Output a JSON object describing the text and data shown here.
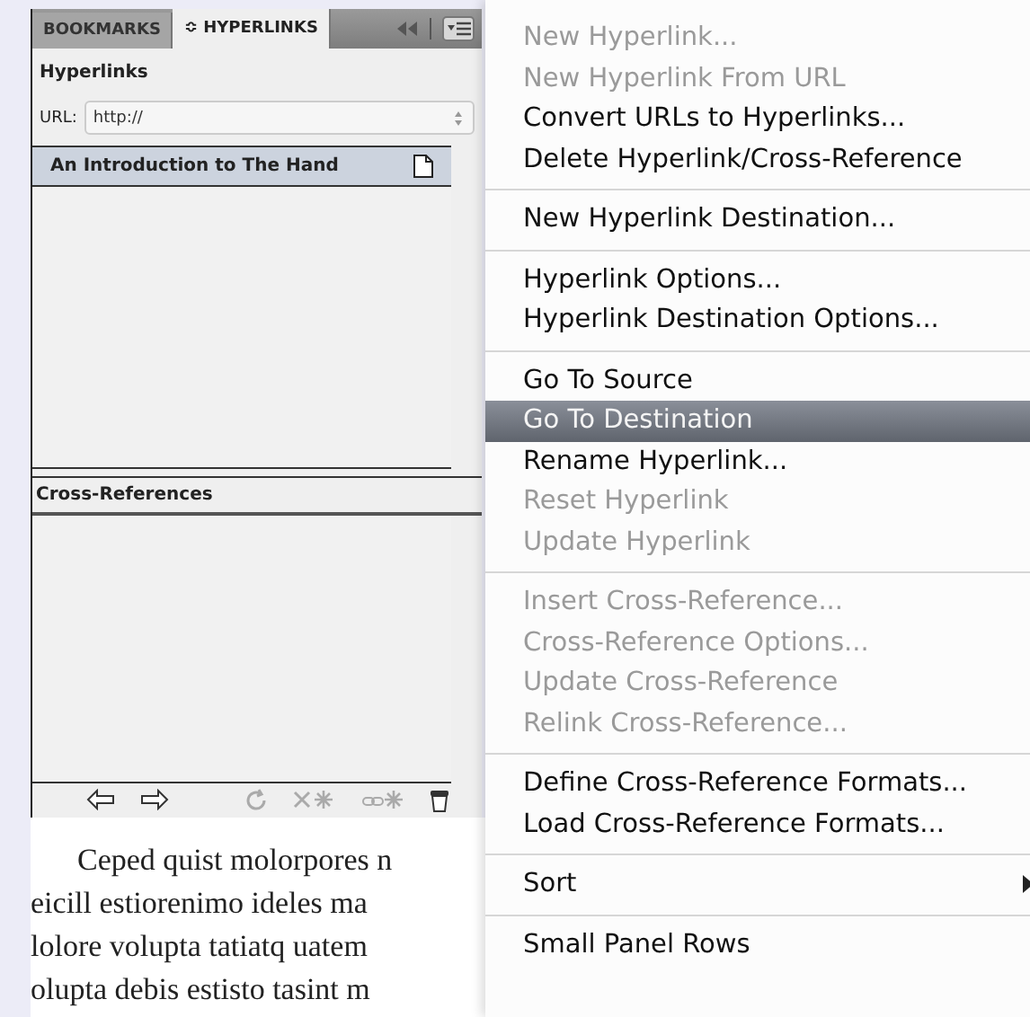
{
  "panel": {
    "tabs": [
      {
        "label": "BOOKMARKS",
        "selected": false
      },
      {
        "label": "≎ HYPERLINKS",
        "selected": true
      }
    ],
    "section_title": "Hyperlinks",
    "url_label": "URL:",
    "url_value": "http://",
    "hyperlinks": [
      {
        "name": "An Introduction to The Hand",
        "selected": true
      }
    ],
    "cross_references_title": "Cross-References"
  },
  "document": {
    "lines": [
      "Ceped quist molorpores n",
      "eicill estiorenimo ideles ma",
      "lolore volupta tatiatq uatem",
      "olupta debis estisto tasint m"
    ]
  },
  "menu": {
    "groups": [
      [
        {
          "label": "New Hyperlink...",
          "disabled": true,
          "selected": false,
          "submenu": false
        },
        {
          "label": "New Hyperlink From URL",
          "disabled": true,
          "selected": false,
          "submenu": false
        },
        {
          "label": "Convert URLs to Hyperlinks...",
          "disabled": false,
          "selected": false,
          "submenu": false
        },
        {
          "label": "Delete Hyperlink/Cross-Reference",
          "disabled": false,
          "selected": false,
          "submenu": false
        }
      ],
      [
        {
          "label": "New Hyperlink Destination...",
          "disabled": false,
          "selected": false,
          "submenu": false
        }
      ],
      [
        {
          "label": "Hyperlink Options...",
          "disabled": false,
          "selected": false,
          "submenu": false
        },
        {
          "label": "Hyperlink Destination Options...",
          "disabled": false,
          "selected": false,
          "submenu": false
        }
      ],
      [
        {
          "label": "Go To Source",
          "disabled": false,
          "selected": false,
          "submenu": false
        },
        {
          "label": "Go To Destination",
          "disabled": false,
          "selected": true,
          "submenu": false
        },
        {
          "label": "Rename Hyperlink...",
          "disabled": false,
          "selected": false,
          "submenu": false
        },
        {
          "label": "Reset Hyperlink",
          "disabled": true,
          "selected": false,
          "submenu": false
        },
        {
          "label": "Update Hyperlink",
          "disabled": true,
          "selected": false,
          "submenu": false
        }
      ],
      [
        {
          "label": "Insert Cross-Reference...",
          "disabled": true,
          "selected": false,
          "submenu": false
        },
        {
          "label": "Cross-Reference Options...",
          "disabled": true,
          "selected": false,
          "submenu": false
        },
        {
          "label": "Update Cross-Reference",
          "disabled": true,
          "selected": false,
          "submenu": false
        },
        {
          "label": "Relink Cross-Reference...",
          "disabled": true,
          "selected": false,
          "submenu": false
        }
      ],
      [
        {
          "label": "Define Cross-Reference Formats...",
          "disabled": false,
          "selected": false,
          "submenu": false
        },
        {
          "label": "Load Cross-Reference Formats...",
          "disabled": false,
          "selected": false,
          "submenu": false
        }
      ],
      [
        {
          "label": "Sort",
          "disabled": false,
          "selected": false,
          "submenu": true
        }
      ],
      [
        {
          "label": "Small Panel Rows",
          "disabled": false,
          "selected": false,
          "submenu": false
        }
      ]
    ]
  }
}
